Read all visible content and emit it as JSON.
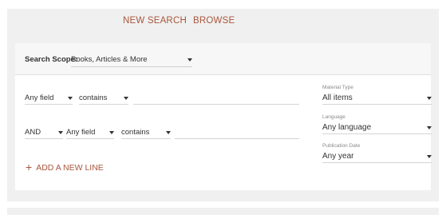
{
  "nav": {
    "new_search": "NEW SEARCH",
    "browse": "BROWSE"
  },
  "scope": {
    "label": "Search Scope:",
    "value": "Books, Articles & More"
  },
  "query_lines": [
    {
      "field": "Any field",
      "operator": "contains",
      "value": ""
    },
    {
      "boolean": "AND",
      "field": "Any field",
      "operator": "contains",
      "value": ""
    }
  ],
  "filters": {
    "material_type": {
      "label": "Material Type",
      "value": "All items"
    },
    "language": {
      "label": "Language",
      "value": "Any language"
    },
    "publication_date": {
      "label": "Publication Date",
      "value": "Any year"
    }
  },
  "add_line": {
    "icon": "plus-icon",
    "label": "ADD A NEW LINE"
  },
  "colors": {
    "accent": "#a8563c",
    "panel_bg": "#f0f0f0",
    "scope_bg": "#f7f7f7"
  }
}
